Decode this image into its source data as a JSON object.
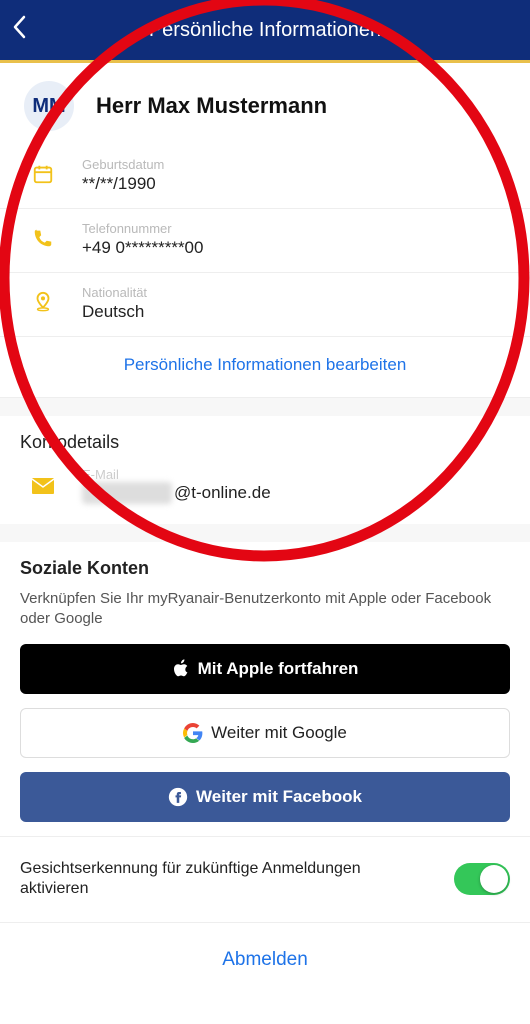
{
  "header": {
    "title": "Persönliche Informationen"
  },
  "user": {
    "initials": "MM",
    "display_name": "Herr Max Mustermann"
  },
  "personal": {
    "birthdate_label": "Geburtsdatum",
    "birthdate_value": "**/**/1990",
    "phone_label": "Telefonnummer",
    "phone_value": "+49 0*********00",
    "nationality_label": "Nationalität",
    "nationality_value": "Deutsch",
    "edit_link": "Persönliche Informationen bearbeiten"
  },
  "account": {
    "section_title": "Kontodetails",
    "email_label": "E-Mail",
    "email_visible_suffix": "@t-online.de"
  },
  "social": {
    "section_title": "Soziale Konten",
    "section_sub": "Verknüpfen Sie Ihr myRyanair-Benutzerkonto mit Apple oder Facebook oder Google",
    "apple_label": "Mit Apple fortfahren",
    "google_label": "Weiter mit Google",
    "facebook_label": "Weiter mit Facebook"
  },
  "faceid": {
    "label": "Gesichtserkennung für zukünftige Anmeldungen aktivieren",
    "enabled": true
  },
  "logout_label": "Abmelden",
  "colors": {
    "brand_blue": "#0f2d7a",
    "brand_gold": "#e9c04b",
    "link_blue": "#1e73e8",
    "toggle_green": "#34c759",
    "facebook_blue": "#3b5998"
  }
}
